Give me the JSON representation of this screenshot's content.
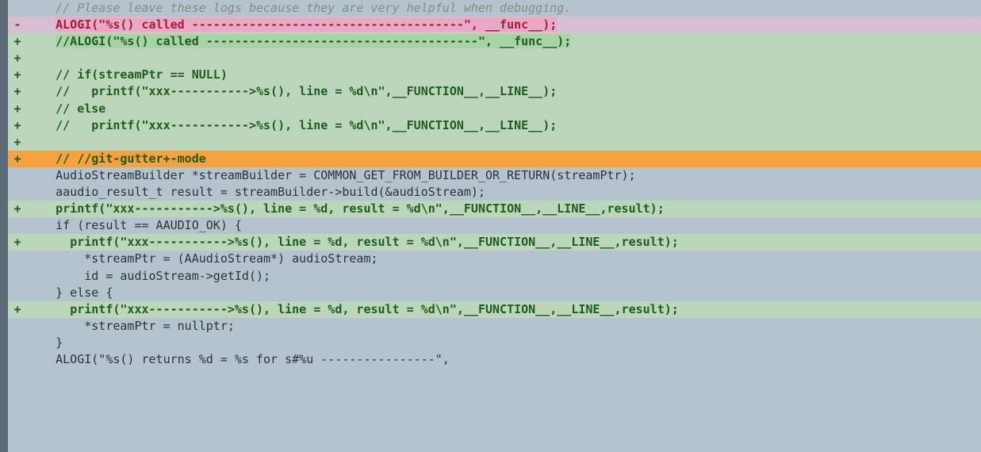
{
  "colors": {
    "bg_context": "#b4c3cd",
    "bg_removed": "#d7bed2",
    "bg_added": "#bcd6bc",
    "bg_refine_removed": "#e8a9c5",
    "bg_refine_added": "#a6d4a6",
    "bg_highlight": "#f6a23e",
    "fringe": "#5b6a74",
    "comment": "#888a85",
    "removed_fg": "#a31d3b",
    "added_fg": "#1f5d1f",
    "normal_fg": "#2e3436"
  },
  "diff": {
    "lines": [
      {
        "type": "context",
        "gutter": " ",
        "indent": "    ",
        "text": "// Please leave these logs because they are very helpful when debugging.",
        "style": "comment"
      },
      {
        "type": "removed",
        "gutter": "-",
        "indent": "    ",
        "text": "ALOGI(\"%s() called --------------------------------------\", __func__);",
        "style": "removed",
        "refine": true
      },
      {
        "type": "added",
        "gutter": "+",
        "indent": "    ",
        "text": "//ALOGI(\"%s() called --------------------------------------\", __func__);",
        "style": "added",
        "refine": true
      },
      {
        "type": "added",
        "gutter": "+",
        "indent": "",
        "text": "",
        "style": "added"
      },
      {
        "type": "added",
        "gutter": "+",
        "indent": "    ",
        "text": "// if(streamPtr == NULL)",
        "style": "added"
      },
      {
        "type": "added",
        "gutter": "+",
        "indent": "    ",
        "text": "//   printf(\"xxx----------->%s(), line = %d\\n\",__FUNCTION__,__LINE__);",
        "style": "added"
      },
      {
        "type": "added",
        "gutter": "+",
        "indent": "    ",
        "text": "// else",
        "style": "added"
      },
      {
        "type": "added",
        "gutter": "+",
        "indent": "    ",
        "text": "//   printf(\"xxx----------->%s(), line = %d\\n\",__FUNCTION__,__LINE__);",
        "style": "added"
      },
      {
        "type": "added",
        "gutter": "+",
        "indent": "",
        "text": "",
        "style": "added"
      },
      {
        "type": "highlight",
        "gutter": "+",
        "indent": "    ",
        "text": "// //git-gutter+-mode",
        "style": "hl-added"
      },
      {
        "type": "context",
        "gutter": " ",
        "indent": "    ",
        "text": "AudioStreamBuilder *streamBuilder = COMMON_GET_FROM_BUILDER_OR_RETURN(streamPtr);",
        "style": "normal"
      },
      {
        "type": "context",
        "gutter": " ",
        "indent": "    ",
        "text": "aaudio_result_t result = streamBuilder->build(&audioStream);",
        "style": "normal"
      },
      {
        "type": "added",
        "gutter": "+",
        "indent": "    ",
        "text": "printf(\"xxx----------->%s(), line = %d, result = %d\\n\",__FUNCTION__,__LINE__,result);",
        "style": "added"
      },
      {
        "type": "context",
        "gutter": " ",
        "indent": "    ",
        "text": "if (result == AAUDIO_OK) {",
        "style": "normal"
      },
      {
        "type": "added",
        "gutter": "+",
        "indent": "      ",
        "text": "printf(\"xxx----------->%s(), line = %d, result = %d\\n\",__FUNCTION__,__LINE__,result);",
        "style": "added"
      },
      {
        "type": "context",
        "gutter": " ",
        "indent": "        ",
        "text": "*streamPtr = (AAudioStream*) audioStream;",
        "style": "normal"
      },
      {
        "type": "context",
        "gutter": " ",
        "indent": "        ",
        "text": "id = audioStream->getId();",
        "style": "normal"
      },
      {
        "type": "context",
        "gutter": " ",
        "indent": "    ",
        "text": "} else {",
        "style": "normal"
      },
      {
        "type": "added",
        "gutter": "+",
        "indent": "      ",
        "text": "printf(\"xxx----------->%s(), line = %d, result = %d\\n\",__FUNCTION__,__LINE__,result);",
        "style": "added"
      },
      {
        "type": "context",
        "gutter": " ",
        "indent": "        ",
        "text": "*streamPtr = nullptr;",
        "style": "normal"
      },
      {
        "type": "context",
        "gutter": " ",
        "indent": "    ",
        "text": "}",
        "style": "normal"
      },
      {
        "type": "context",
        "gutter": " ",
        "indent": "    ",
        "text": "ALOGI(\"%s() returns %d = %s for s#%u ----------------\",",
        "style": "normal"
      }
    ]
  }
}
